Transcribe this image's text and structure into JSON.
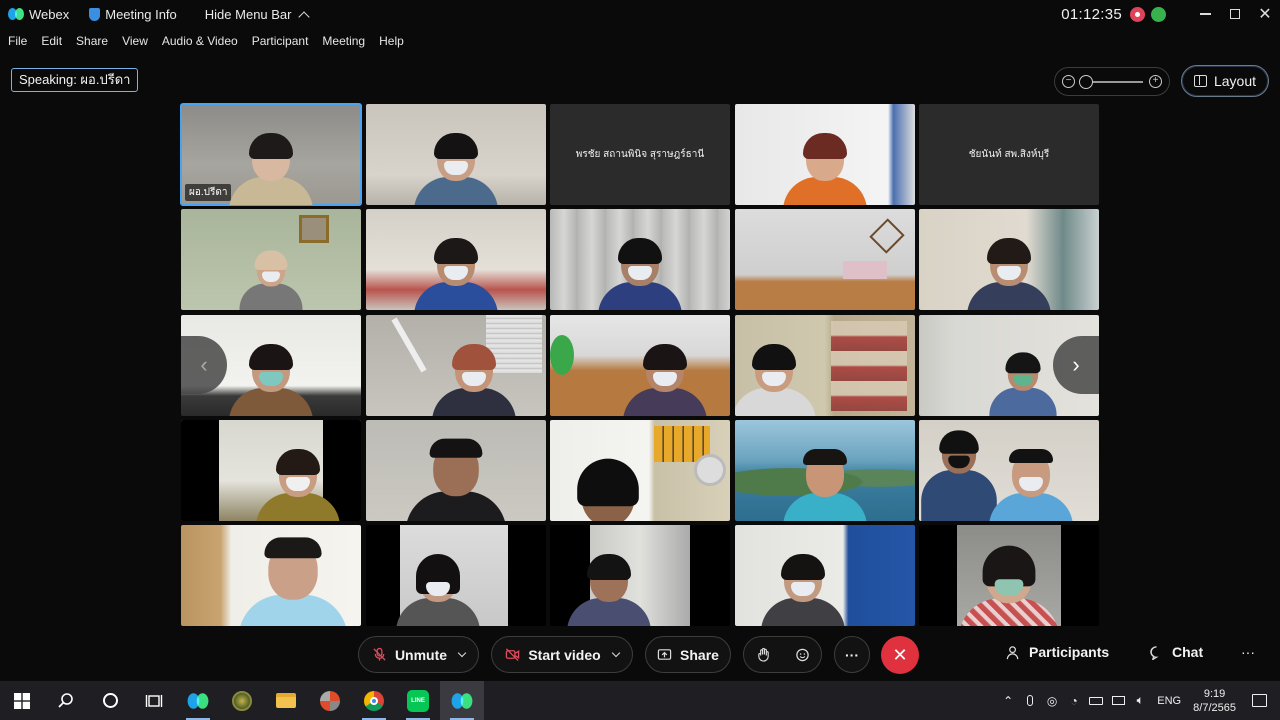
{
  "titlebar": {
    "app_name": "Webex",
    "meeting_info": "Meeting Info",
    "hide_menu": "Hide Menu Bar",
    "timer": "01:12:35"
  },
  "menu": [
    "File",
    "Edit",
    "Share",
    "View",
    "Audio & Video",
    "Participant",
    "Meeting",
    "Help"
  ],
  "speaking": "Speaking: ผอ.ปรีดา",
  "layout_label": "Layout",
  "tiles": {
    "t1_name": "ผอ.ปรีดา",
    "t3_name": "พรชัย สถานพินิจ สุราษฎร์ธานี",
    "t5_name": "ชัยนันท์ สพ.สิงห์บุรี"
  },
  "controls": {
    "unmute": "Unmute",
    "start_video": "Start video",
    "share": "Share",
    "participants": "Participants",
    "chat": "Chat",
    "more": "···"
  },
  "taskbar": {
    "lang": "ENG",
    "time": "9:19",
    "date": "8/7/2565"
  },
  "colors": {
    "accent_blue": "#4aa3f0",
    "end_call_red": "#e0323e",
    "recording_red": "#e0425a",
    "network_green": "#37b24d"
  }
}
